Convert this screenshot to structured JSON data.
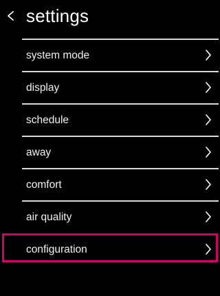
{
  "header": {
    "back_icon": "chevron-left-icon",
    "title": "settings"
  },
  "menu": {
    "items": [
      {
        "label": "system mode",
        "icon": "chevron-right-icon",
        "selected": false
      },
      {
        "label": "display",
        "icon": "chevron-right-icon",
        "selected": false
      },
      {
        "label": "schedule",
        "icon": "chevron-right-icon",
        "selected": false
      },
      {
        "label": "away",
        "icon": "chevron-right-icon",
        "selected": false
      },
      {
        "label": "comfort",
        "icon": "chevron-right-icon",
        "selected": false
      },
      {
        "label": "air quality",
        "icon": "chevron-right-icon",
        "selected": false
      },
      {
        "label": "configuration",
        "icon": "chevron-right-icon",
        "selected": true
      }
    ]
  },
  "colors": {
    "background": "#000000",
    "text": "#ffffff",
    "divider": "#d9d9d9",
    "selection_border": "#d4006a"
  }
}
